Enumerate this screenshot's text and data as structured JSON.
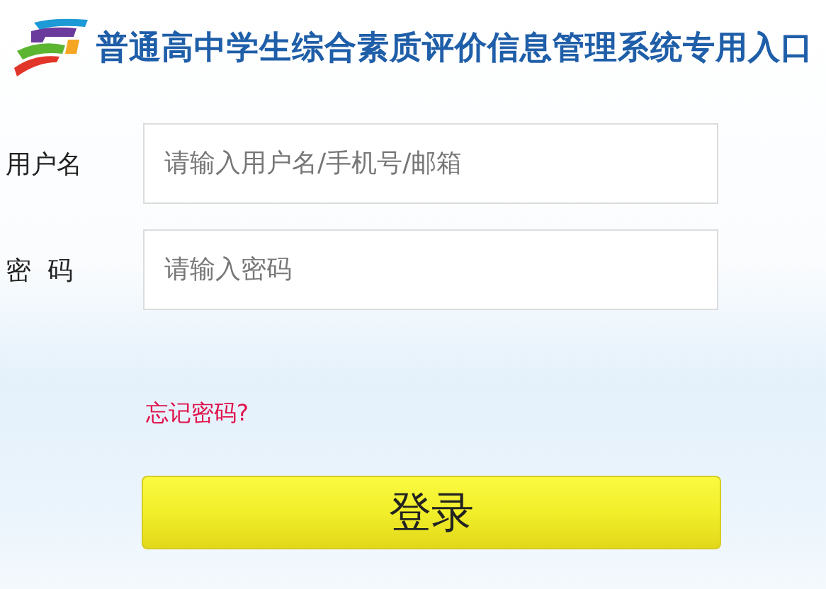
{
  "header": {
    "title": "普通高中学生综合素质评价信息管理系统专用入口"
  },
  "form": {
    "fields": [
      {
        "label": "用户名",
        "placeholder": "请输入用户名/手机号/邮箱"
      },
      {
        "label": "密  码",
        "placeholder": "请输入密码"
      }
    ],
    "forgot_link": "忘记密码?",
    "login_button": "登录"
  }
}
